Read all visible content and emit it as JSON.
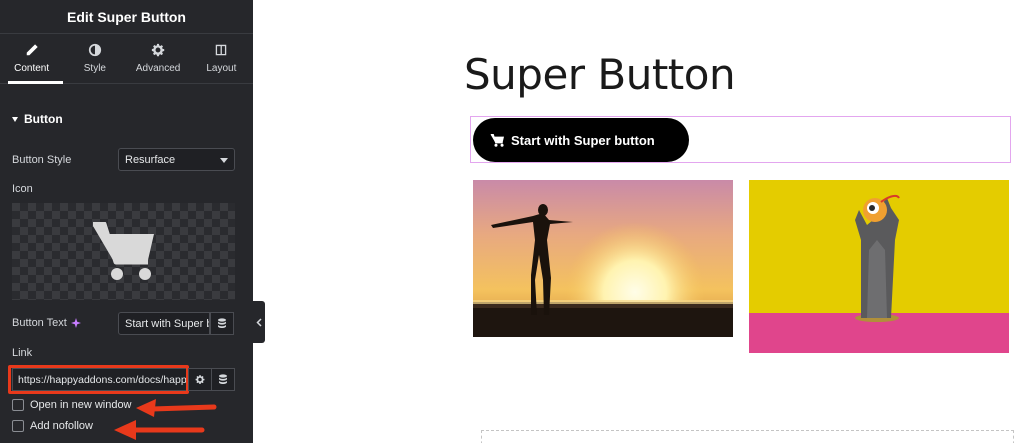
{
  "panel": {
    "header_title": "Edit Super Button",
    "tabs": [
      {
        "label": "Content",
        "icon": "pencil-icon",
        "active": true
      },
      {
        "label": "Style",
        "icon": "half-circle-icon",
        "active": false
      },
      {
        "label": "Advanced",
        "icon": "gear-icon",
        "active": false
      },
      {
        "label": "Layout",
        "icon": "layout-icon",
        "active": false
      }
    ],
    "section_title": "Button",
    "button_style_label": "Button Style",
    "button_style_value": "Resurface",
    "icon_label": "Icon",
    "icon_value": "cart-icon",
    "button_text_label": "Button Text",
    "button_text_value": "Start with Super b",
    "link_label": "Link",
    "link_value": "https://happyaddons.com/docs/happy",
    "open_new_window_label": "Open in new window",
    "add_nofollow_label": "Add nofollow"
  },
  "canvas": {
    "page_title": "Super Button",
    "button_label": "Start with Super button"
  },
  "colors": {
    "panel_bg": "#26272b",
    "highlight": "#e8391b",
    "widget_outline": "#e3a6ef"
  }
}
